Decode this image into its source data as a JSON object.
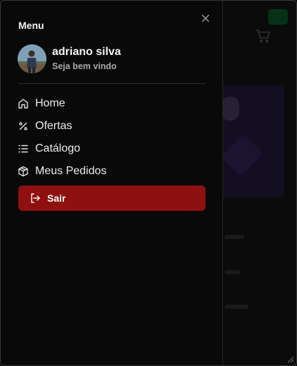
{
  "drawer": {
    "title": "Menu",
    "close_icon": "close-icon"
  },
  "profile": {
    "name": "adriano silva",
    "subtitle": "Seja bem vindo",
    "avatar": "avatar-photo"
  },
  "nav": {
    "items": [
      {
        "label": "Home",
        "icon": "home-icon"
      },
      {
        "label": "Ofertas",
        "icon": "percent-icon"
      },
      {
        "label": "Catálogo",
        "icon": "list-icon"
      },
      {
        "label": "Meus Pedidos",
        "icon": "package-icon"
      }
    ]
  },
  "logout": {
    "label": "Sair",
    "icon": "logout-icon",
    "color": "#8f1010"
  },
  "colors": {
    "drawer_bg": "#0a0909",
    "accent_green": "#0f6e33"
  }
}
